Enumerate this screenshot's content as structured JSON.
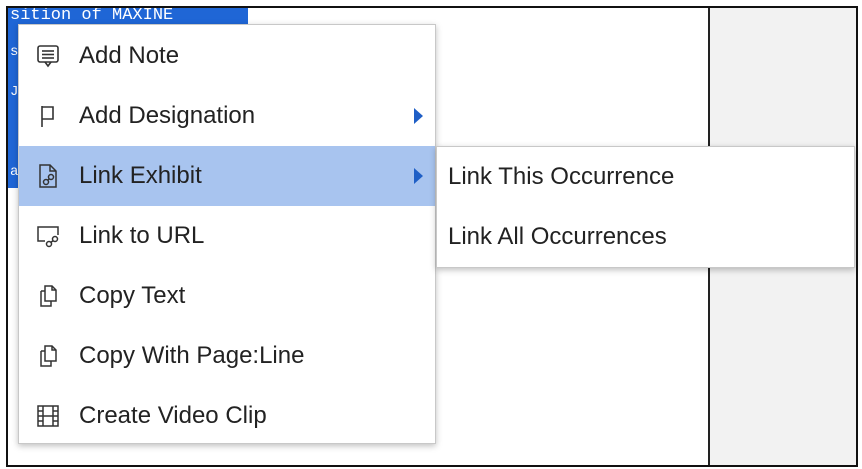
{
  "document": {
    "selected_text_top": "sition of MAXINE",
    "selected_strip_chars": [
      "s",
      "J",
      "a"
    ]
  },
  "context_menu": {
    "items": [
      {
        "label": "Add Note",
        "icon": "note-icon"
      },
      {
        "label": "Add Designation",
        "icon": "flag-icon",
        "has_submenu": true
      },
      {
        "label": "Link Exhibit",
        "icon": "link-exhibit-icon",
        "has_submenu": true,
        "highlighted": true
      },
      {
        "label": "Link to URL",
        "icon": "link-url-icon"
      },
      {
        "label": "Copy Text",
        "icon": "copy-icon"
      },
      {
        "label": "Copy With Page:Line",
        "icon": "copy-icon"
      },
      {
        "label": "Create Video Clip",
        "icon": "film-icon"
      }
    ]
  },
  "submenu": {
    "items": [
      {
        "label": "Link This Occurrence"
      },
      {
        "label": "Link All Occurrences"
      }
    ]
  },
  "colors": {
    "selection": "#1f66d6",
    "highlight": "#a8c4ef",
    "arrow": "#1f5fc6"
  }
}
